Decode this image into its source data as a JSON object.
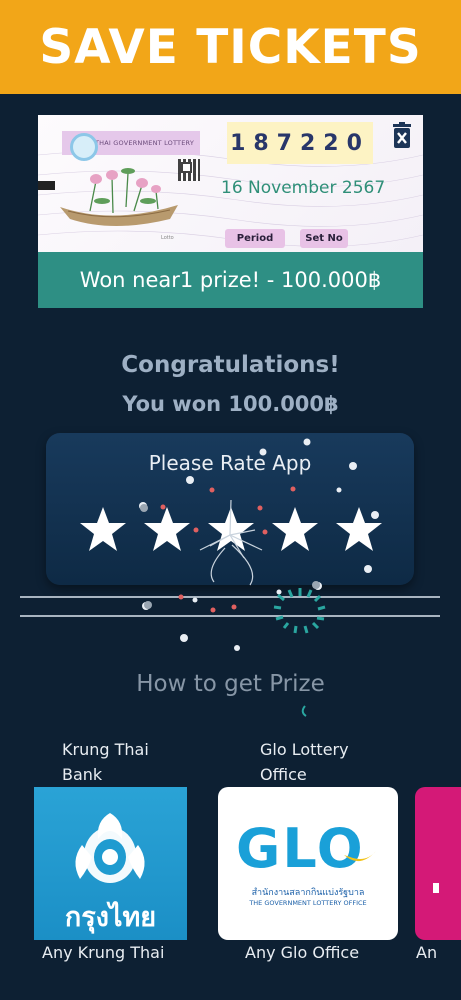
{
  "header": {
    "title": "SAVE TICKETS"
  },
  "ticket": {
    "lottery_label": "THAI GOVERNMENT LOTTERY",
    "number": "187220",
    "date": "16 November 2567",
    "period_label": "Period",
    "setno_label": "Set No",
    "tiny_logo": "Lotto",
    "result_text": "Won near1 prize! - 100.000฿",
    "close_icon": "trash-close-icon"
  },
  "congrats": {
    "title": "Congratulations!",
    "won_text": "You won 100.000฿"
  },
  "rating": {
    "title": "Please Rate App",
    "star_count": 5
  },
  "prize": {
    "title": "How to get Prize",
    "banks": [
      {
        "label_line1": "Krung Thai",
        "label_line2": "Bank",
        "logo_text": "กรุงไทย",
        "caption": "Any Krung Thai",
        "color": "#1f9bd0"
      },
      {
        "label_line1": "Glo Lottery",
        "label_line2": "Office",
        "logo_text": "GLO",
        "logo_sub_th": "สำนักงานสลากกินแบ่งรัฐบาล",
        "logo_sub_en": "THE GOVERNMENT LOTTERY OFFICE",
        "caption": "Any Glo Office",
        "color": "#1aa0d8"
      },
      {
        "caption": "An",
        "color": "#d41977"
      }
    ]
  },
  "colors": {
    "header": "#f2a618",
    "background": "#0d2033",
    "ticket_footer": "#2e8f84",
    "ticket_number": "#28366a"
  }
}
